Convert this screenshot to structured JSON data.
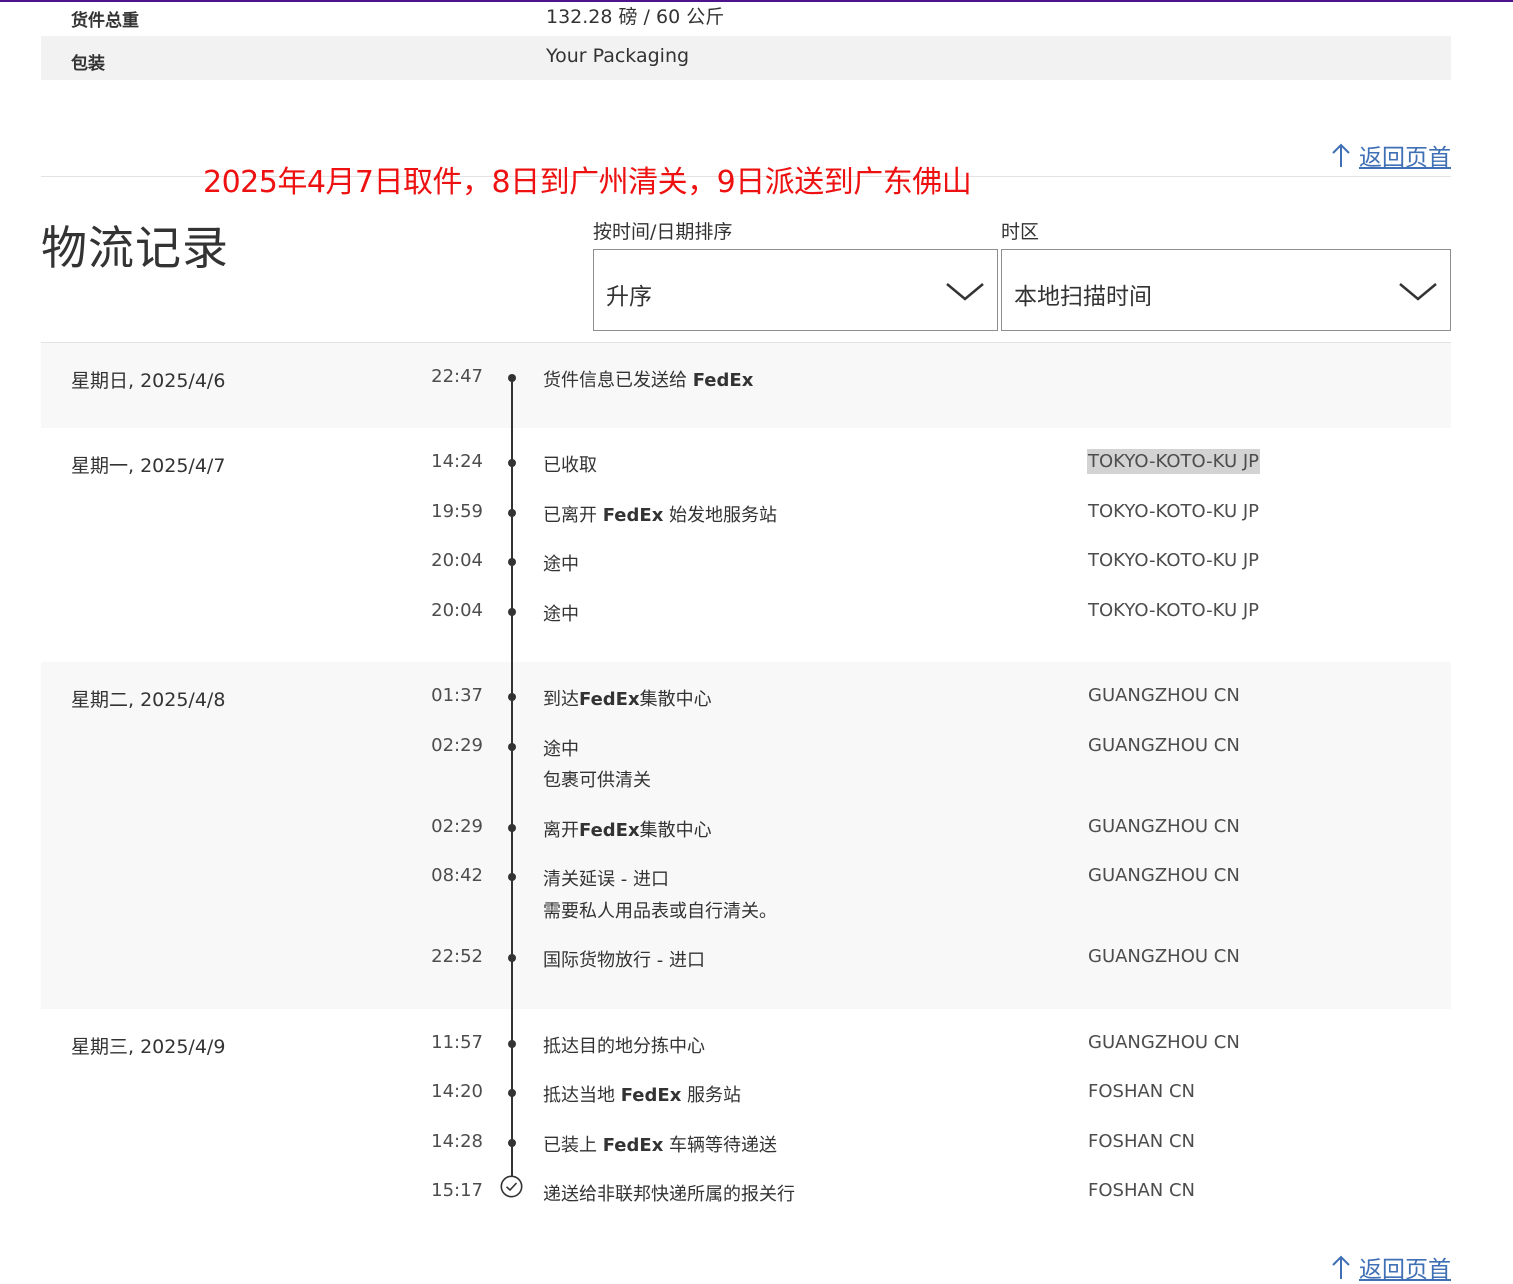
{
  "details": {
    "weight_label": "货件总重",
    "weight_value": "132.28 磅 / 60 公斤",
    "packaging_label": "包装",
    "packaging_value": "Your Packaging"
  },
  "back_to_top": "返回页首",
  "annotation": "2025年4月7日取件，8日到广州清关，9日派送到广东佛山",
  "history": {
    "title": "物流记录",
    "sort_label": "按时间/日期排序",
    "sort_value": "升序",
    "tz_label": "时区",
    "tz_value": "本地扫描时间"
  },
  "days": [
    {
      "label": "星期日, 2025/4/6",
      "events": [
        {
          "time": "22:47",
          "pre": "货件信息已发送给 ",
          "bold": "FedEx",
          "post": "",
          "note": "",
          "loc": ""
        }
      ]
    },
    {
      "label": "星期一, 2025/4/7",
      "events": [
        {
          "time": "14:24",
          "pre": "已收取",
          "bold": "",
          "post": "",
          "note": "",
          "loc": "TOKYO-KOTO-KU JP"
        },
        {
          "time": "19:59",
          "pre": "已离开 ",
          "bold": "FedEx",
          "post": " 始发地服务站",
          "note": "",
          "loc": "TOKYO-KOTO-KU JP"
        },
        {
          "time": "20:04",
          "pre": "途中",
          "bold": "",
          "post": "",
          "note": "",
          "loc": "TOKYO-KOTO-KU JP"
        },
        {
          "time": "20:04",
          "pre": "途中",
          "bold": "",
          "post": "",
          "note": "",
          "loc": "TOKYO-KOTO-KU JP"
        }
      ]
    },
    {
      "label": "星期二, 2025/4/8",
      "events": [
        {
          "time": "01:37",
          "pre": "到达",
          "bold": "FedEx",
          "post": "集散中心",
          "note": "",
          "loc": "GUANGZHOU CN"
        },
        {
          "time": "02:29",
          "pre": "途中",
          "bold": "",
          "post": "",
          "note": "包裹可供清关",
          "loc": "GUANGZHOU CN"
        },
        {
          "time": "02:29",
          "pre": "离开",
          "bold": "FedEx",
          "post": "集散中心",
          "note": "",
          "loc": "GUANGZHOU CN"
        },
        {
          "time": "08:42",
          "pre": "清关延误 - 进口",
          "bold": "",
          "post": "",
          "note": "需要私人用品表或自行清关。",
          "loc": "GUANGZHOU CN"
        },
        {
          "time": "22:52",
          "pre": "国际货物放行 - 进口",
          "bold": "",
          "post": "",
          "note": "",
          "loc": "GUANGZHOU CN"
        }
      ]
    },
    {
      "label": "星期三, 2025/4/9",
      "events": [
        {
          "time": "11:57",
          "pre": "抵达目的地分拣中心",
          "bold": "",
          "post": "",
          "note": "",
          "loc": "GUANGZHOU CN"
        },
        {
          "time": "14:20",
          "pre": "抵达当地 ",
          "bold": "FedEx",
          "post": " 服务站",
          "note": "",
          "loc": "FOSHAN CN"
        },
        {
          "time": "14:28",
          "pre": "已装上 ",
          "bold": "FedEx",
          "post": " 车辆等待递送",
          "note": "",
          "loc": "FOSHAN CN"
        },
        {
          "time": "15:17",
          "pre": "递送给非联邦快递所属的报关行",
          "bold": "",
          "post": "",
          "note": "",
          "loc": "FOSHAN CN"
        }
      ]
    }
  ],
  "colors": {
    "brand_purple": "#4d148c",
    "link_blue": "#3f6fb5",
    "annotation_red": "#ee1111"
  }
}
